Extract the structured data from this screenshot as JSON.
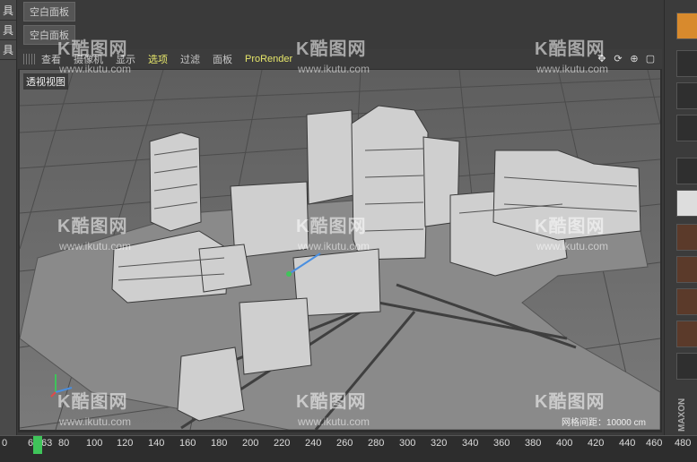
{
  "left_panel": {
    "labels": [
      "具",
      "具",
      "具"
    ]
  },
  "panel_tabs": [
    "空白面板",
    "空白面板"
  ],
  "viewport": {
    "menu": [
      "查看",
      "摄像机",
      "显示",
      "选项",
      "过滤",
      "面板",
      "ProRender"
    ],
    "active_menu": "选项",
    "view_label": "透视视图",
    "grid_readout": "网格间距：10000 cm"
  },
  "timeline": {
    "ticks": [
      "0",
      "6",
      "63",
      "80",
      "100",
      "120",
      "140",
      "160",
      "180",
      "200",
      "220",
      "240",
      "260",
      "280",
      "300",
      "320",
      "340",
      "360",
      "380",
      "400",
      "420",
      "440",
      "460",
      "480"
    ],
    "current_frame": "63"
  },
  "watermark": {
    "brand": "K酷图网",
    "url": "www.ikutu.com"
  },
  "right_panel": {
    "brand": "MAXON"
  }
}
